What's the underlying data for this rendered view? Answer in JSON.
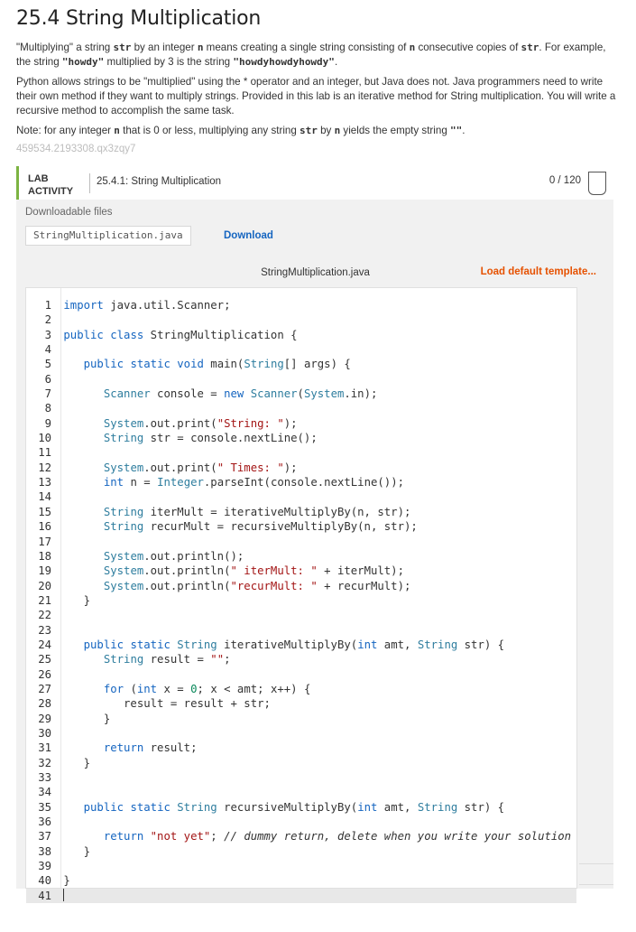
{
  "title": "25.4 String Multiplication",
  "para1": {
    "t1": "\"Multiplying\" a string ",
    "c1": "str",
    "t2": " by an integer ",
    "c2": "n",
    "t3": " means creating a single string consisting of ",
    "c3": "n",
    "t4": " consecutive copies of ",
    "c4": "str",
    "t5": ". For example, the string ",
    "c5": "\"howdy\"",
    "t6": " multiplied by 3 is the string ",
    "c6": "\"howdyhowdyhowdy\"",
    "t7": "."
  },
  "para2": "Python allows strings to be \"multiplied\" using the * operator and an integer, but Java does not. Java programmers need to write their own method if they want to multiply strings. Provided in this lab is an iterative method for String multiplication. You will write a recursive method to accomplish the same task.",
  "para3": {
    "t1": "Note: for any integer ",
    "c1": "n",
    "t2": " that is 0 or less, multiplying any string ",
    "c2": "str",
    "t3": " by ",
    "c3": "n",
    "t4": " yields the empty string ",
    "c4": "\"\"",
    "t5": "."
  },
  "hash_id": "459534.2193308.qx3zqy7",
  "lab": {
    "badge": "LAB ACTIVITY",
    "title": "25.4.1: String Multiplication",
    "score": "0 / 120",
    "downloads_label": "Downloadable files",
    "file_name": "StringMultiplication.java",
    "download_label": "Download",
    "editor_filename": "StringMultiplication.java",
    "load_default_label": "Load default template...",
    "accent_color": "#7cb342"
  },
  "code_lines": [
    "import java.util.Scanner;",
    "",
    "public class StringMultiplication {",
    "",
    "   public static void main(String[] args) {",
    "",
    "      Scanner console = new Scanner(System.in);",
    "",
    "      System.out.print(\"String: \");",
    "      String str = console.nextLine();",
    "",
    "      System.out.print(\" Times: \");",
    "      int n = Integer.parseInt(console.nextLine());",
    "",
    "      String iterMult = iterativeMultiplyBy(n, str);",
    "      String recurMult = recursiveMultiplyBy(n, str);",
    "",
    "      System.out.println();",
    "      System.out.println(\" iterMult: \" + iterMult);",
    "      System.out.println(\"recurMult: \" + recurMult);",
    "   }",
    "",
    "",
    "   public static String iterativeMultiplyBy(int amt, String str) {",
    "      String result = \"\";",
    "",
    "      for (int x = 0; x < amt; x++) {",
    "         result = result + str;",
    "      }",
    "",
    "      return result;",
    "   }",
    "",
    "",
    "   public static String recursiveMultiplyBy(int amt, String str) {",
    "",
    "      return \"not yet\"; // dummy return, delete when you write your solution",
    "   }",
    "",
    "}",
    ""
  ],
  "current_line": 41
}
